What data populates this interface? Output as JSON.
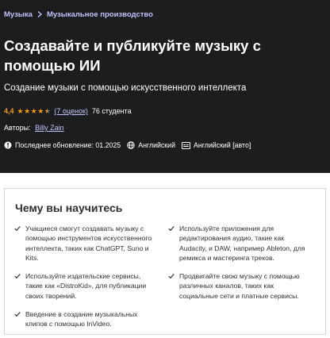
{
  "breadcrumb": {
    "items": [
      "Музыка",
      "Музыкальное производство"
    ]
  },
  "course": {
    "title": "Создавайте и публикуйте музыку с помощью ИИ",
    "subtitle": "Создание музыки с помощью искусственного интеллекта",
    "rating_value": "4,4",
    "rating_numeric": 4.4,
    "rating_count": "(7 оценок)",
    "students": "76 студента",
    "authors_label": "Авторы:",
    "author": "Billy Zain",
    "last_updated": "Последнее обновление: 01.2025",
    "language": "Английский",
    "captions": "Английский [авто]"
  },
  "learn": {
    "title": "Чему вы научитесь",
    "left": [
      "Учащиеся смогут создавать музыку с помощью инструментов искусственного интеллекта, таких как ChatGPT, Suno и Kits.",
      "Используйте издательские сервисы, такие как «DistroKid», для публикации своих творений.",
      "Введение в создание музыкальных клипов с помощью InVideo."
    ],
    "right": [
      "Используйте приложения для редактирования аудио, такие как Audacity, и DAW, например Ableton, для ремикса и мастеринга треков.",
      "Продвигайте свою музыку с помощью различных каналов, таких как социальные сети и платные сервисы."
    ]
  },
  "colors": {
    "hero_bg": "#1c1d1f",
    "link": "#c0c4fc",
    "star": "#f69c08",
    "text_dark": "#2d2f31"
  },
  "icons": {
    "breadcrumb_separator": "chevron-right-icon",
    "star": "star-icon",
    "update": "alert-badge-icon",
    "language": "globe-icon",
    "captions": "closed-captions-icon",
    "check": "checkmark-icon"
  }
}
